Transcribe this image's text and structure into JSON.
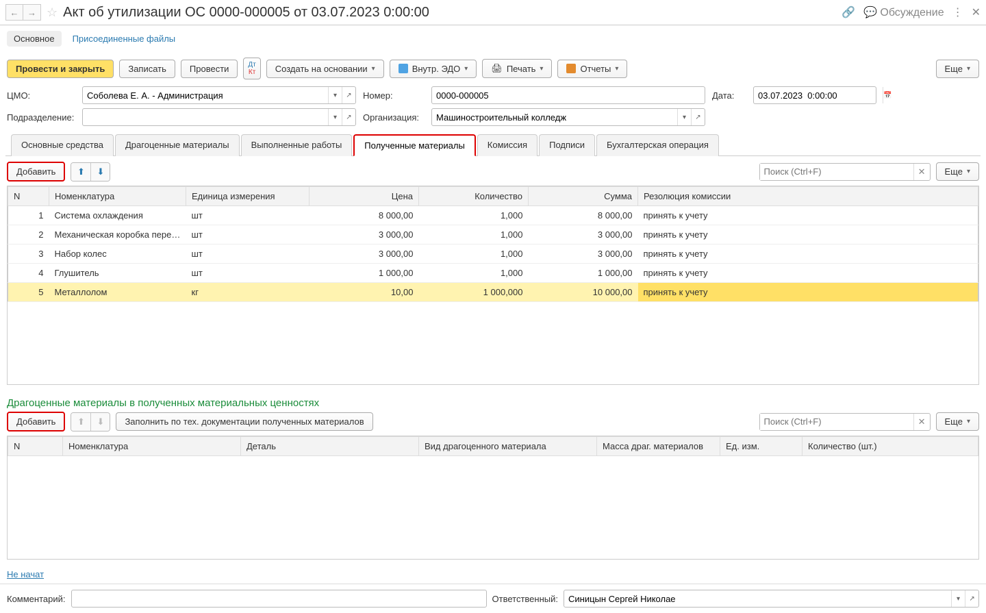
{
  "header": {
    "title": "Акт об утилизации ОС 0000-000005 от 03.07.2023 0:00:00",
    "discussion": "Обсуждение"
  },
  "subnav": {
    "main": "Основное",
    "attached": "Присоединенные файлы"
  },
  "toolbar": {
    "post_close": "Провести и закрыть",
    "save": "Записать",
    "post": "Провести",
    "create_based": "Создать на основании",
    "edo": "Внутр. ЭДО",
    "print": "Печать",
    "reports": "Отчеты",
    "more": "Еще"
  },
  "form": {
    "cmo_label": "ЦМО:",
    "cmo_value": "Соболева Е. А. - Администрация",
    "number_label": "Номер:",
    "number_value": "0000-000005",
    "date_label": "Дата:",
    "date_value": "03.07.2023  0:00:00",
    "dept_label": "Подразделение:",
    "dept_value": "",
    "org_label": "Организация:",
    "org_value": "Машиностроительный колледж"
  },
  "tabs": [
    "Основные средства",
    "Драгоценные материалы",
    "Выполненные работы",
    "Полученные материалы",
    "Комиссия",
    "Подписи",
    "Бухгалтерская операция"
  ],
  "active_tab": 3,
  "materials": {
    "add": "Добавить",
    "search_placeholder": "Поиск (Ctrl+F)",
    "more": "Еще",
    "columns": [
      "N",
      "Номенклатура",
      "Единица измерения",
      "Цена",
      "Количество",
      "Сумма",
      "Резолюция комиссии"
    ],
    "rows": [
      {
        "n": "1",
        "name": "Система охлаждения",
        "unit": "шт",
        "price": "8 000,00",
        "qty": "1,000",
        "sum": "8 000,00",
        "res": "принять к учету"
      },
      {
        "n": "2",
        "name": "Механическая коробка пере…",
        "unit": "шт",
        "price": "3 000,00",
        "qty": "1,000",
        "sum": "3 000,00",
        "res": "принять к учету"
      },
      {
        "n": "3",
        "name": "Набор колес",
        "unit": "шт",
        "price": "3 000,00",
        "qty": "1,000",
        "sum": "3 000,00",
        "res": "принять к учету"
      },
      {
        "n": "4",
        "name": "Глушитель",
        "unit": "шт",
        "price": "1 000,00",
        "qty": "1,000",
        "sum": "1 000,00",
        "res": "принять к учету"
      },
      {
        "n": "5",
        "name": "Металлолом",
        "unit": "кг",
        "price": "10,00",
        "qty": "1 000,000",
        "sum": "10 000,00",
        "res": "принять к учету"
      }
    ]
  },
  "precious": {
    "title": "Драгоценные материалы в полученных материальных ценностях",
    "add": "Добавить",
    "fill": "Заполнить по тех. документации полученных материалов",
    "search_placeholder": "Поиск (Ctrl+F)",
    "more": "Еще",
    "columns": [
      "N",
      "Номенклатура",
      "Деталь",
      "Вид драгоценного материала",
      "Масса драг. материалов",
      "Ед. изм.",
      "Количество (шт.)"
    ]
  },
  "footer": {
    "status": "Не начат",
    "comment_label": "Комментарий:",
    "comment_value": "",
    "responsible_label": "Ответственный:",
    "responsible_value": "Синицын Сергей Николае"
  }
}
